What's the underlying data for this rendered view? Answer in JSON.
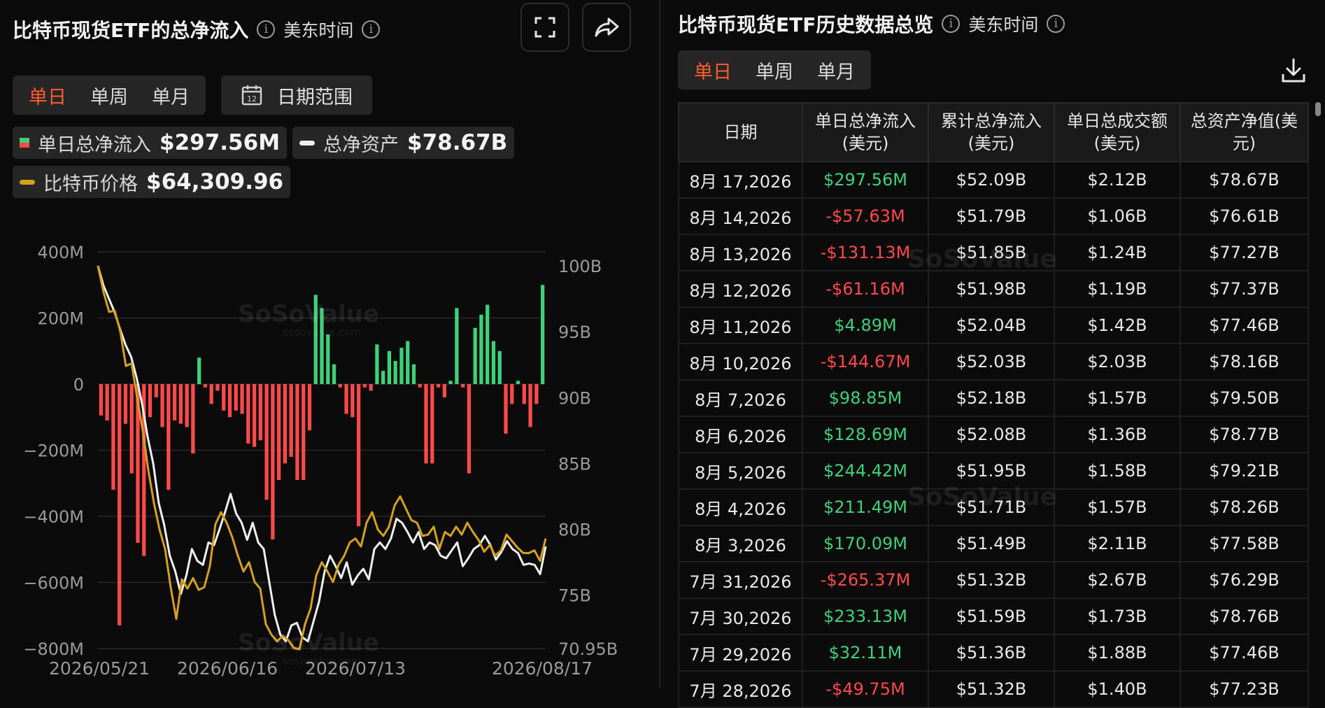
{
  "left": {
    "title": "比特币现货ETF的总净流入",
    "timezone": "美东时间",
    "tabs": [
      "单日",
      "单周",
      "单月"
    ],
    "active_tab": "单日",
    "date_range_label": "日期范围",
    "calendar_day": "12",
    "legend": {
      "inflow_label": "单日总净流入",
      "inflow_value": "$297.56M",
      "assets_label": "总净资产",
      "assets_value": "$78.67B",
      "price_label": "比特币价格",
      "price_value": "$64,309.96"
    },
    "watermark": "SoSoValue",
    "watermark_sub": "sosovalue.com"
  },
  "right": {
    "title": "比特币现货ETF历史数据总览",
    "timezone": "美东时间",
    "tabs": [
      "单日",
      "单周",
      "单月"
    ],
    "active_tab": "单日",
    "columns": [
      "日期",
      "单日总净流入\n(美元)",
      "累计总净流入\n(美元)",
      "单日总成交额\n(美元)",
      "总资产净值(美\n元)"
    ],
    "rows": [
      [
        "8月 17,2026",
        "$297.56M",
        "$52.09B",
        "$2.12B",
        "$78.67B"
      ],
      [
        "8月 14,2026",
        "-$57.63M",
        "$51.79B",
        "$1.06B",
        "$76.61B"
      ],
      [
        "8月 13,2026",
        "-$131.13M",
        "$51.85B",
        "$1.24B",
        "$77.27B"
      ],
      [
        "8月 12,2026",
        "-$61.16M",
        "$51.98B",
        "$1.19B",
        "$77.37B"
      ],
      [
        "8月 11,2026",
        "$4.89M",
        "$52.04B",
        "$1.42B",
        "$77.46B"
      ],
      [
        "8月 10,2026",
        "-$144.67M",
        "$52.03B",
        "$2.03B",
        "$78.16B"
      ],
      [
        "8月 7,2026",
        "$98.85M",
        "$52.18B",
        "$1.57B",
        "$79.50B"
      ],
      [
        "8月 6,2026",
        "$128.69M",
        "$52.08B",
        "$1.36B",
        "$78.77B"
      ],
      [
        "8月 5,2026",
        "$244.42M",
        "$51.95B",
        "$1.58B",
        "$79.21B"
      ],
      [
        "8月 4,2026",
        "$211.49M",
        "$51.71B",
        "$1.57B",
        "$78.26B"
      ],
      [
        "8月 3,2026",
        "$170.09M",
        "$51.49B",
        "$2.11B",
        "$77.58B"
      ],
      [
        "7月 31,2026",
        "-$265.37M",
        "$51.32B",
        "$2.67B",
        "$76.29B"
      ],
      [
        "7月 30,2026",
        "$233.13M",
        "$51.59B",
        "$1.73B",
        "$78.76B"
      ],
      [
        "7月 29,2026",
        "$32.11M",
        "$51.36B",
        "$1.88B",
        "$77.46B"
      ],
      [
        "7月 28,2026",
        "-$49.75M",
        "$51.32B",
        "$1.40B",
        "$77.23B"
      ]
    ]
  },
  "colors": {
    "accent": "#ff5b2e",
    "positive": "#3fd07a",
    "negative": "#ff4a4a",
    "price": "#d4a020",
    "assets": "#f0f0f0"
  },
  "chart_data": {
    "type": "bar",
    "left_axis_ticks": [
      "400M",
      "200M",
      "0",
      "−200M",
      "−400M",
      "−600M",
      "−800M"
    ],
    "right_axis_ticks": [
      "100B",
      "95B",
      "90B",
      "85B",
      "80B",
      "75B",
      "70.95B"
    ],
    "x_ticks": [
      "2026/05/21",
      "2026/06/16",
      "2026/07/13",
      "2026/08/17"
    ],
    "ylim_left": [
      -800,
      400
    ],
    "ylim_right": [
      70.95,
      100
    ],
    "grid": true,
    "series": [
      {
        "name": "单日总净流入",
        "unit": "M USD",
        "axis": "left",
        "values": [
          -95,
          -110,
          -320,
          -730,
          -120,
          -270,
          -480,
          -520,
          -100,
          -40,
          -130,
          -320,
          -110,
          -120,
          -130,
          -210,
          80,
          -10,
          -60,
          -20,
          -80,
          -100,
          -80,
          -90,
          -180,
          -190,
          -170,
          -350,
          -470,
          -290,
          -240,
          -220,
          -290,
          -290,
          -140,
          270,
          230,
          150,
          60,
          -10,
          -90,
          -100,
          -430,
          -10,
          -20,
          120,
          40,
          100,
          70,
          110,
          130,
          60,
          -10,
          -240,
          -240,
          -10,
          -40,
          10,
          230,
          -10,
          -270,
          170,
          210,
          240,
          130,
          100,
          -150,
          -60,
          10,
          -60,
          -130,
          -60,
          300
        ]
      },
      {
        "name": "总净资产",
        "unit": "B USD",
        "axis": "right",
        "values": [
          100,
          98.5,
          97.5,
          96.5,
          95.2,
          94,
          93.1,
          91.5,
          89.5,
          87,
          85,
          82,
          80.3,
          78,
          76.8,
          75.1,
          76.5,
          78.5,
          77.6,
          77.3,
          79,
          78.8,
          80,
          81.3,
          82.7,
          81.2,
          80.5,
          79.2,
          80.5,
          79,
          78.5,
          76,
          73.5,
          72,
          71.5,
          72.7,
          72.9,
          71.8,
          71.5,
          73,
          74.5,
          76.8,
          78,
          77.2,
          76.3,
          77.5,
          75.8,
          76.5,
          77,
          76.2,
          78.5,
          79,
          78.5,
          79.3,
          80.8,
          80.5,
          79.8,
          79,
          79.8,
          78.5,
          79,
          78.8,
          78,
          77.8,
          78.4,
          79,
          77.2,
          77.8,
          78.5,
          78.8,
          79.5,
          78.8,
          77.7,
          78.3,
          79.1,
          78.5,
          78.2,
          77.3,
          77.4,
          77.3,
          76.6,
          78.7
        ]
      },
      {
        "name": "比特币价格",
        "axis": "right",
        "values": [
          100,
          98,
          96.5,
          96.6,
          95,
          92.4,
          92.6,
          90,
          87.5,
          84.5,
          82,
          80,
          78.5,
          75.6,
          73.2,
          76.2,
          75.5,
          76.3,
          75.4,
          75.6,
          77.2,
          80.4,
          81.3,
          80.5,
          79.4,
          78,
          76.8,
          77.5,
          76,
          75.5,
          72.8,
          72,
          71.5,
          71.9,
          71.6,
          71,
          70.9,
          72.8,
          74,
          76.5,
          77.5,
          76.8,
          76,
          77.3,
          78,
          79,
          79.3,
          78.7,
          80.5,
          81.3,
          80,
          79.5,
          80.2,
          81.8,
          82.5,
          81.6,
          80.7,
          80.5,
          79.5,
          79.6,
          80.2,
          78.5,
          79.8,
          79.5,
          80.2,
          79.6,
          80.5,
          79.8,
          79.2,
          78.3,
          78.8,
          78,
          78.4,
          79.6,
          79.1,
          78.6,
          78.2,
          78.2,
          78.4,
          77.6,
          79.3
        ]
      }
    ]
  }
}
